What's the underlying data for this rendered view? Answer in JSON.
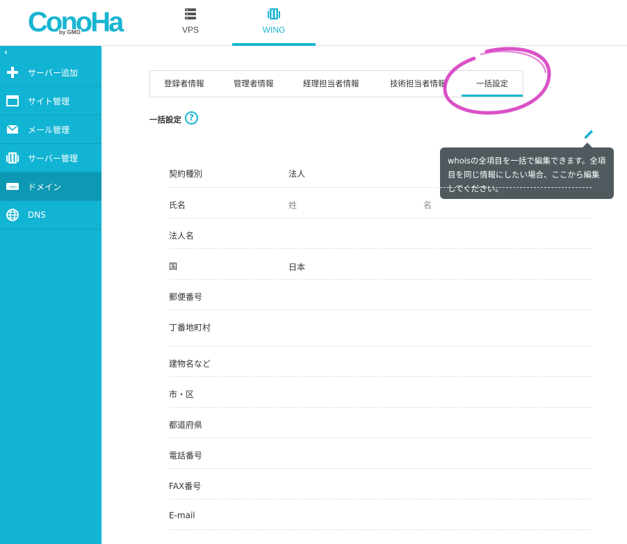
{
  "header": {
    "logo": "ConoHa",
    "logo_sub": "by GMO",
    "nav": [
      {
        "label": "VPS",
        "icon": "server-icon"
      },
      {
        "label": "WING",
        "icon": "wing-server-icon",
        "active": true
      }
    ]
  },
  "sidebar": {
    "collapse_label": "‹",
    "items": [
      {
        "label": "サーバー追加",
        "icon": "plus-icon"
      },
      {
        "label": "サイト管理",
        "icon": "window-icon"
      },
      {
        "label": "メール管理",
        "icon": "mail-icon"
      },
      {
        "label": "サーバー管理",
        "icon": "server-manage-icon"
      },
      {
        "label": "ドメイン",
        "icon": "domain-icon",
        "active": true
      },
      {
        "label": "DNS",
        "icon": "globe-icon"
      }
    ]
  },
  "tabs": [
    {
      "label": "登録者情報"
    },
    {
      "label": "管理者情報"
    },
    {
      "label": "経理担当者情報"
    },
    {
      "label": "技術担当者情報"
    },
    {
      "label": "一括設定",
      "active": true
    }
  ],
  "section": {
    "title": "一括設定",
    "help": "?"
  },
  "tooltip": {
    "text": "whoisの全項目を一括で編集できます。全項目を同じ情報にしたい場合、ここから編集してください。"
  },
  "form": {
    "rows": [
      {
        "label": "契約種別",
        "value": "法人"
      },
      {
        "label": "氏名",
        "value": "姓",
        "value2": "名"
      },
      {
        "label": "法人名",
        "value": ""
      },
      {
        "label": "国",
        "value": "日本"
      },
      {
        "label": "郵便番号",
        "value": ""
      },
      {
        "label": "丁番地町村",
        "value": ""
      },
      {
        "label": "建物名など",
        "value": ""
      },
      {
        "label": "市・区",
        "value": ""
      },
      {
        "label": "都道府県",
        "value": ""
      },
      {
        "label": "電話番号",
        "value": ""
      },
      {
        "label": "FAX番号",
        "value": ""
      },
      {
        "label": "E-mail",
        "value": ""
      }
    ]
  },
  "colors": {
    "brand": "#19b5d1",
    "sidebar": "#12b4d3",
    "sidebar_active": "#0d98b3",
    "tooltip_bg": "#505a5e",
    "annotation": "#d63ec2"
  }
}
